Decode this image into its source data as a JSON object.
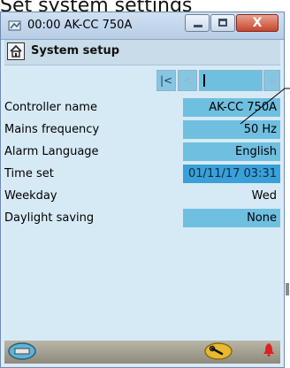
{
  "caption": "Set system settings",
  "window": {
    "title": "00:00 AK-CC 750A",
    "close_label": "X"
  },
  "header": {
    "title": "System setup"
  },
  "pager": {
    "first_glyph": "|<",
    "prev_glyph": "<",
    "next_glyph": "+"
  },
  "settings": [
    {
      "label": "Controller name",
      "value": "AK-CC 750A"
    },
    {
      "label": "Mains frequency",
      "value": "50 Hz"
    },
    {
      "label": "Alarm Language",
      "value": "English"
    },
    {
      "label": "Time set",
      "value": "01/11/17 03:31"
    },
    {
      "label": "Weekday",
      "value": "Wed"
    },
    {
      "label": "Daylight saving",
      "value": "None"
    }
  ],
  "colors": {
    "field": "#6fbfe0",
    "selected_field": "#3aa0d8",
    "client_bg": "#d6eaf6",
    "alarm": "#e02020"
  },
  "icons": {
    "home": "home-icon",
    "toolbar_left": "keyboard-icon",
    "toolbar_mid": "wrench-icon",
    "alarm": "alarm-bell-icon"
  }
}
